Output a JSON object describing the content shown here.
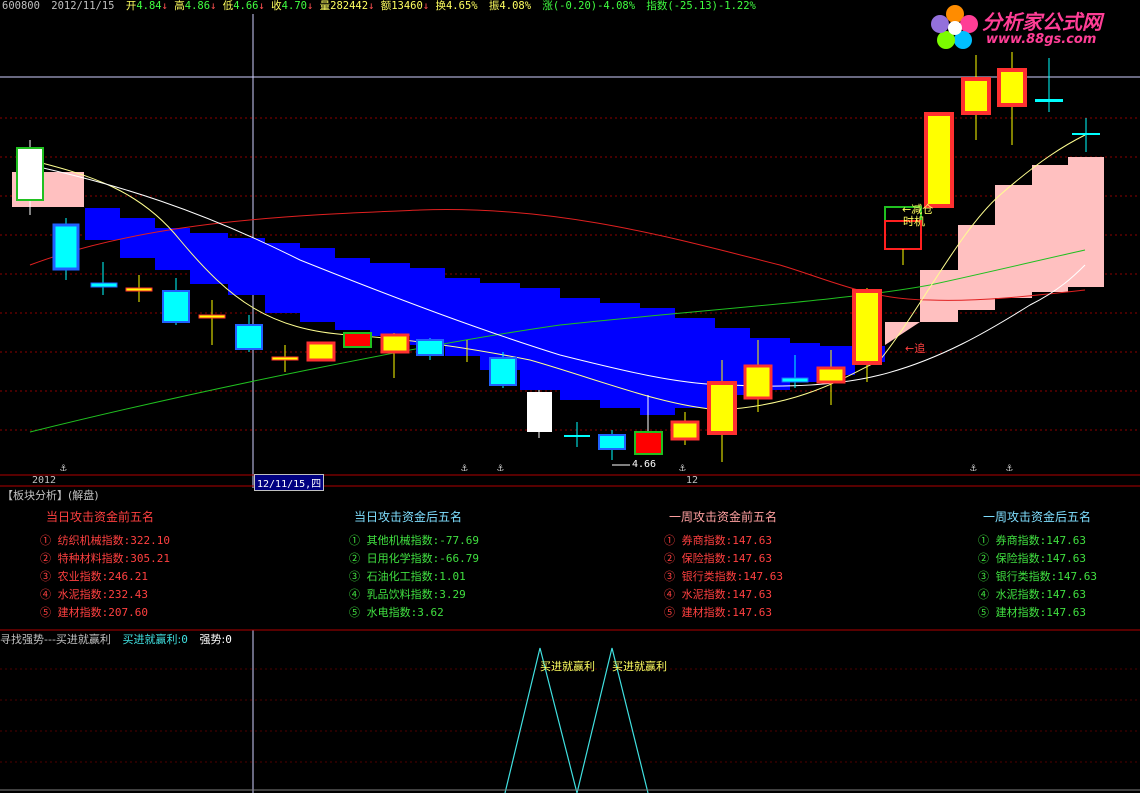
{
  "header": {
    "code": "600800",
    "date": "2012/11/15",
    "open_label": "开",
    "open": "4.84",
    "high_label": "高",
    "high": "4.86",
    "low_label": "低",
    "low": "4.66",
    "close_label": "收",
    "close": "4.70",
    "volume_label": "量",
    "volume": "282442",
    "amount_label": "额",
    "amount": "13460",
    "turnover_label": "换",
    "turnover": "4.65%",
    "amplitude_label": "振",
    "amplitude": "4.08%",
    "change_label": "涨",
    "change": "(-0.20)-4.08%",
    "index_label": "指数",
    "index": "(-25.13)-1.22%"
  },
  "logo": {
    "name": "分析家公式网",
    "url": "www.88gs.com"
  },
  "chart": {
    "labels": {
      "reduce": "←减仓",
      "timing": "时机",
      "chase": "←追",
      "low_price": "4.66"
    },
    "xaxis": {
      "year": "2012",
      "cursor": "12/11/15,四",
      "month": "12"
    },
    "colors": {
      "bull_body": "#ffff00",
      "bull_edge": "#ff3030",
      "bear": "#00ffff",
      "cloud": "#0000ff",
      "pink": "#ffc0c0"
    }
  },
  "panel": {
    "title": "【板块分析】(解盘)",
    "sections": [
      {
        "title": "当日攻击资金前五名",
        "items": [
          "① 纺织机械指数:322.10",
          "② 特种材料指数:305.21",
          "③ 农业指数:246.21",
          "④ 水泥指数:232.43",
          "⑤ 建材指数:207.60"
        ]
      },
      {
        "title": "当日攻击资金后五名",
        "items": [
          "① 其他机械指数:-77.69",
          "② 日用化学指数:-66.79",
          "③ 石油化工指数:1.01",
          "④ 乳品饮料指数:3.29",
          "⑤ 水电指数:3.62"
        ]
      },
      {
        "title": "一周攻击资金前五名",
        "items": [
          "① 券商指数:147.63",
          "② 保险指数:147.63",
          "③ 银行类指数:147.63",
          "④ 水泥指数:147.63",
          "⑤ 建材指数:147.63"
        ]
      },
      {
        "title": "一周攻击资金后五名",
        "items": [
          "① 券商指数:147.63",
          "② 保险指数:147.63",
          "③ 银行类指数:147.63",
          "④ 水泥指数:147.63",
          "⑤ 建材指数:147.63"
        ]
      }
    ]
  },
  "bottom": {
    "title": "寻找强势---买进就赢利",
    "val1_label": "买进就赢利:",
    "val1": "0",
    "val2_label": "强势:",
    "val2": "0",
    "signal1": "买进就赢利",
    "signal2": "买进就赢利"
  }
}
